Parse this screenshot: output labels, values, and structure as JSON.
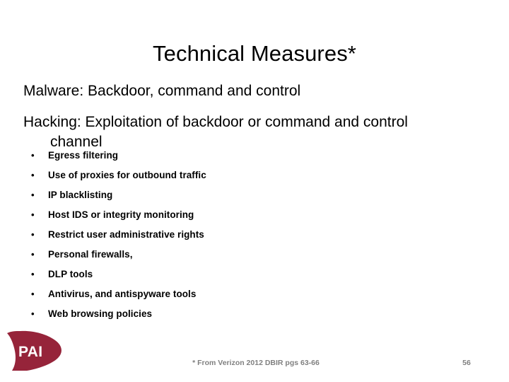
{
  "slide": {
    "title": "Technical Measures*",
    "lead_lines": [
      "Malware: Backdoor, command and control",
      "Hacking: Exploitation of backdoor or command and control channel"
    ],
    "bullets": [
      "Egress filtering",
      "Use of proxies for outbound traffic",
      "IP blacklisting",
      "Host IDS or integrity monitoring",
      "Restrict user administrative rights",
      "Personal firewalls,",
      "DLP tools",
      "Antivirus, and antispyware tools",
      "Web browsing policies"
    ],
    "bullet_glyph": "•",
    "footnote": "* From Verizon 2012 DBIR pgs 63-66",
    "page_number": "56",
    "logo": {
      "name": "pai-logo",
      "text": "PAI",
      "color": "#96243A",
      "text_color": "#FFFFFF"
    },
    "colors": {
      "background": "#FFFFFF",
      "text": "#000000",
      "footer_text": "#808080",
      "accent": "#96243A"
    }
  }
}
